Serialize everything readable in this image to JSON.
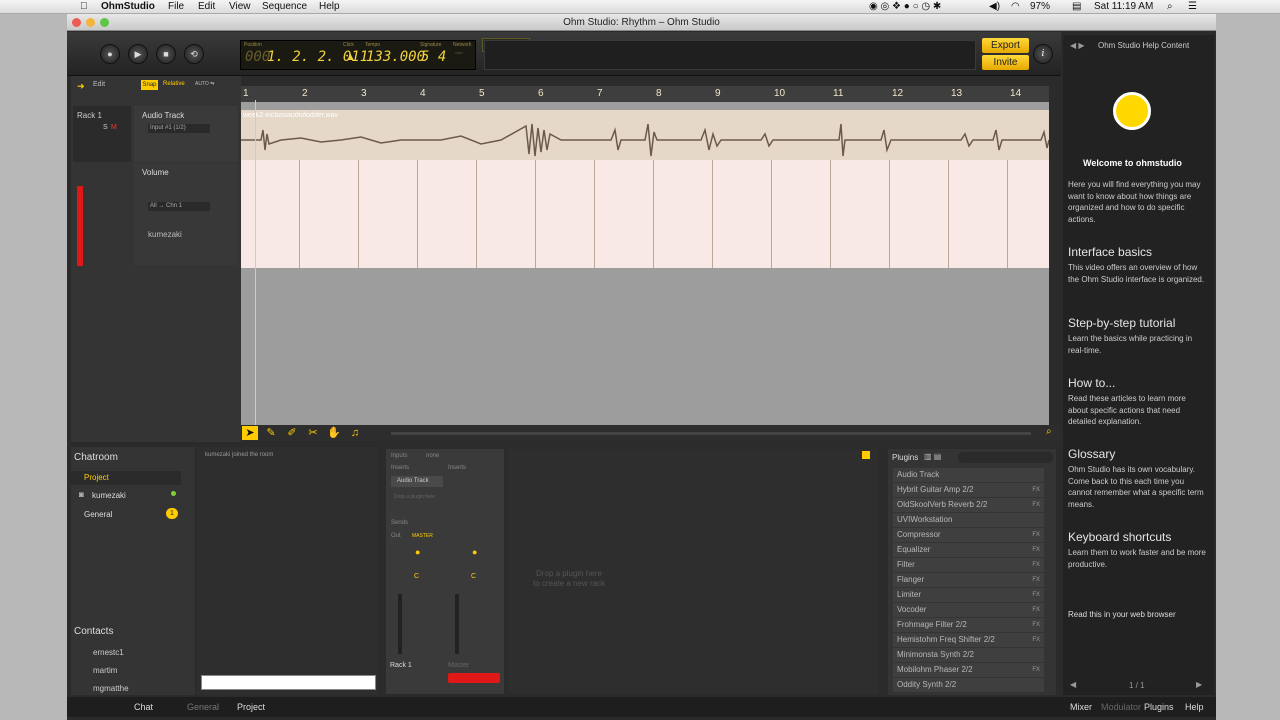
{
  "menubar": {
    "app": "OhmStudio",
    "menus": [
      "File",
      "Edit",
      "View",
      "Sequence",
      "Help"
    ],
    "battery": "97%",
    "clock": "Sat 11:19 AM"
  },
  "window": {
    "title": "Ohm Studio: Rhythm – Ohm Studio"
  },
  "transport": {
    "position_label": "Position",
    "position": "1. 2. 2. 011",
    "click_label": "Click",
    "tempo_label": "Tempo",
    "tempo": "133.000",
    "signature_label": "Signature",
    "signature": "5 4",
    "network_label": "Network"
  },
  "toolbar": {
    "export_label": "Export",
    "invite_label": "Invite",
    "info_icon": "i"
  },
  "editbar": {
    "edit_label": "Edit",
    "snap_label": "Snap",
    "relative_label": "Relative",
    "auto_label": "AUTO ⇆"
  },
  "ruler": {
    "marks": [
      "1",
      "2",
      "3",
      "4",
      "5",
      "6",
      "7",
      "8",
      "9",
      "10",
      "11",
      "12",
      "13",
      "14"
    ]
  },
  "rack": {
    "name": "Rack 1",
    "audio_track": "Audio Track",
    "input": "Input #1 (1/2)",
    "volume": "Volume",
    "routing": "All → Chn 1",
    "user": "kumezaki"
  },
  "clip": {
    "filename": "week2-inclassaudiofodder.wav"
  },
  "chatroom": {
    "title": "Chatroom",
    "project_label": "Project",
    "member": "kumezaki",
    "general_label": "General",
    "general_badge": "1",
    "log": "kumezaki joined the room"
  },
  "contacts": {
    "title": "Contacts",
    "people": [
      "ernestc1",
      "martim",
      "mgmatthe"
    ]
  },
  "mixer": {
    "inputs_label": "Inputs",
    "none_label": "none",
    "inserts_label": "Inserts",
    "track": "Audio Track",
    "drop_plugin": "Drop a plugin here",
    "sends_label": "Sends",
    "out_label": "Out",
    "master_label": "MASTER",
    "pan_value": "C",
    "rack_label": "Rack 1",
    "master_strip": "Master"
  },
  "dropzone": {
    "text1": "Drop a plugin here",
    "text2": "to create a new rack"
  },
  "plugins": {
    "title": "Plugins",
    "items": [
      {
        "name": "Audio Track",
        "tag": ""
      },
      {
        "name": "Hybrit Guitar Amp 2/2",
        "tag": "FX"
      },
      {
        "name": "OldSkoolVerb Reverb 2/2",
        "tag": "FX"
      },
      {
        "name": "UVIWorkstation",
        "tag": ""
      },
      {
        "name": "Compressor",
        "tag": "FX"
      },
      {
        "name": "Equalizer",
        "tag": "FX"
      },
      {
        "name": "Filter",
        "tag": "FX"
      },
      {
        "name": "Flanger",
        "tag": "FX"
      },
      {
        "name": "Limiter",
        "tag": "FX"
      },
      {
        "name": "Vocoder",
        "tag": "FX"
      },
      {
        "name": "Frohmage Filter 2/2",
        "tag": "FX"
      },
      {
        "name": "Hemistohm Freq Shifter 2/2",
        "tag": "FX"
      },
      {
        "name": "Minimonsta Synth 2/2",
        "tag": ""
      },
      {
        "name": "Mobilohm Phaser 2/2",
        "tag": "FX"
      },
      {
        "name": "Oddity Synth 2/2",
        "tag": ""
      }
    ]
  },
  "help": {
    "header": "Ohm Studio Help Content",
    "welcome": "Welcome to ohmstudio",
    "intro": "Here you will find everything you may want to know about how things are organized and how to do specific actions.",
    "sections": [
      {
        "title": "Interface basics",
        "text": "This video offers an overview of how the Ohm Studio interface is organized."
      },
      {
        "title": "Step-by-step tutorial",
        "text": "Learn the basics while practicing in real-time."
      },
      {
        "title": "How to...",
        "text": "Read these articles to learn more about specific actions that need detailed explanation."
      },
      {
        "title": "Glossary",
        "text": "Ohm Studio has its own vocabulary. Come back to this each time you cannot remember what a specific term means."
      },
      {
        "title": "Keyboard shortcuts",
        "text": "Learn them to work faster and be more productive."
      }
    ],
    "browser_link": "Read this in your web browser",
    "pager": "1 / 1"
  },
  "statusbar": {
    "chat": "Chat",
    "general": "General",
    "project": "Project",
    "tabs": [
      "Mixer",
      "Modulator",
      "Plugins",
      "Help"
    ]
  }
}
